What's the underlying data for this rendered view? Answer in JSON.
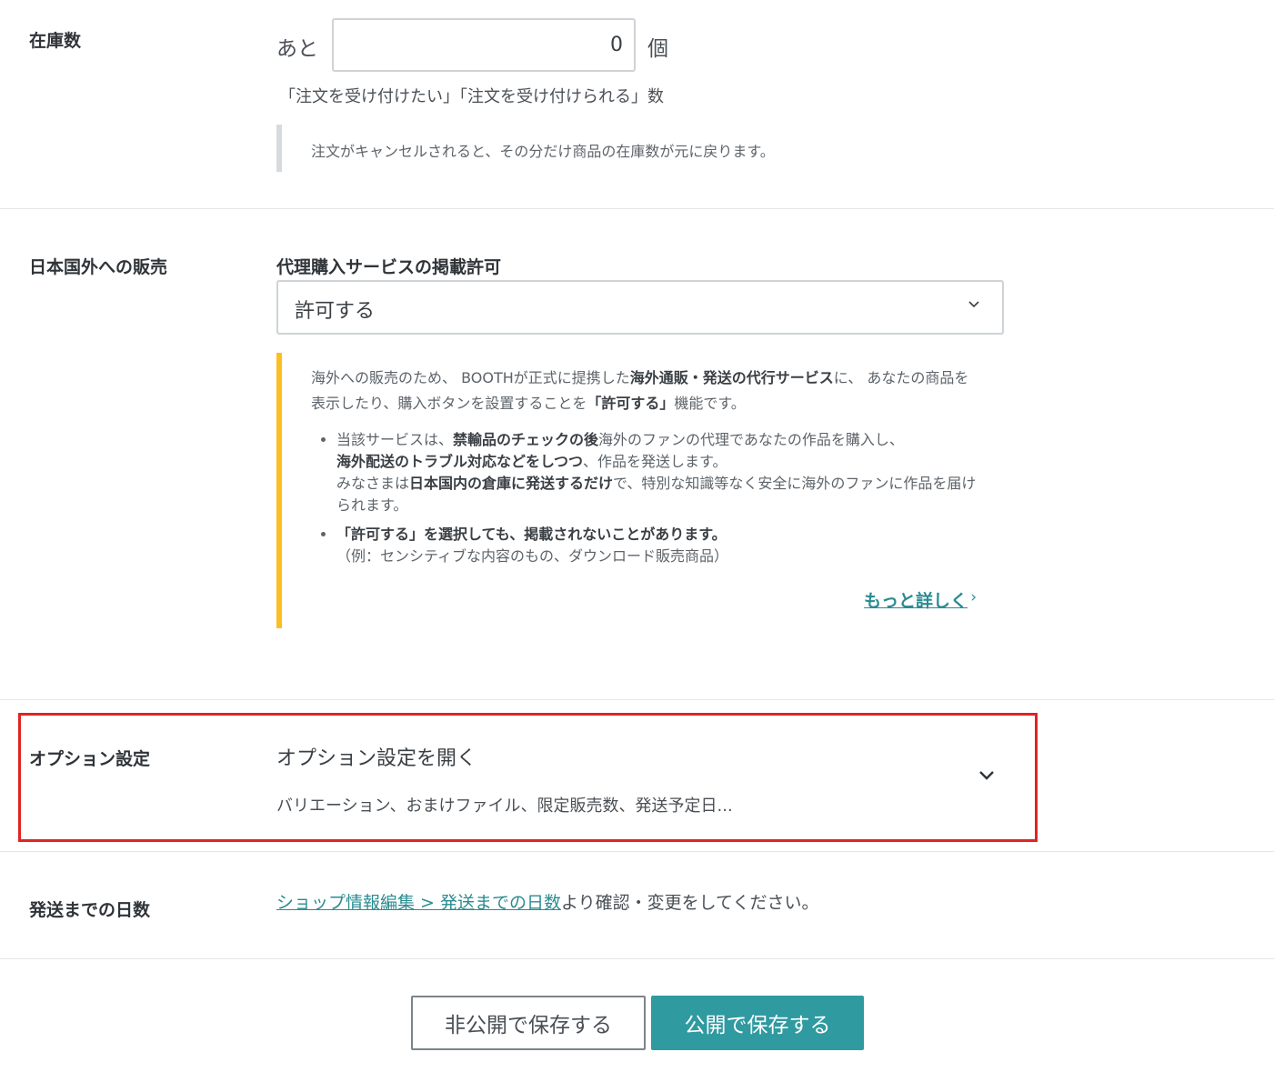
{
  "stock": {
    "label": "在庫数",
    "prefix": "あと",
    "value": "0",
    "suffix": "個",
    "help": "「注文を受け付けたい」「注文を受け付けられる」数",
    "note": "注文がキャンセルされると、その分だけ商品の在庫数が元に戻ります。"
  },
  "overseas": {
    "label": "日本国外への販売",
    "sub_title": "代理購入サービスの掲載許可",
    "selected": "許可する",
    "note": {
      "p1_a": "海外への販売のため、 BOOTHが正式に提携した",
      "p1_b": "海外通販・発送の代行サービス",
      "p1_c": "に、 あなたの商品を表示したり、購入ボタンを設置することを",
      "p1_d": "「許可する」",
      "p1_e": "機能です。",
      "b1_a": "当該サービスは、",
      "b1_b": "禁輸品のチェックの後",
      "b1_c": "海外のファンの代理であなたの作品を購入し、",
      "b1_d": "海外配送のトラブル対応などをしつつ",
      "b1_e": "、作品を発送します。",
      "b1_f": "みなさまは",
      "b1_g": "日本国内の倉庫に発送するだけ",
      "b1_h": "で、特別な知識等なく安全に海外のファンに作品を届けられます。",
      "b2_a": "「許可する」を選択しても、掲載されないことがあります。",
      "b2_b": "（例：センシティブな内容のもの、ダウンロード販売商品）",
      "more": "もっと詳しく",
      "more_chevron": "›"
    }
  },
  "option": {
    "label": "オプション設定",
    "title": "オプション設定を開く",
    "sub": "バリエーション、おまけファイル、限定販売数、発送予定日..."
  },
  "shipping": {
    "label": "発送までの日数",
    "link": "ショップ情報編集 > 発送までの日数",
    "text": "より確認・変更をしてください。"
  },
  "buttons": {
    "private": "非公開で保存する",
    "public": "公開で保存する"
  },
  "colors": {
    "accent": "#2f9aa0",
    "link": "#2a8c91",
    "warning_bar": "#fbbf24",
    "highlight_box": "#e02424"
  }
}
